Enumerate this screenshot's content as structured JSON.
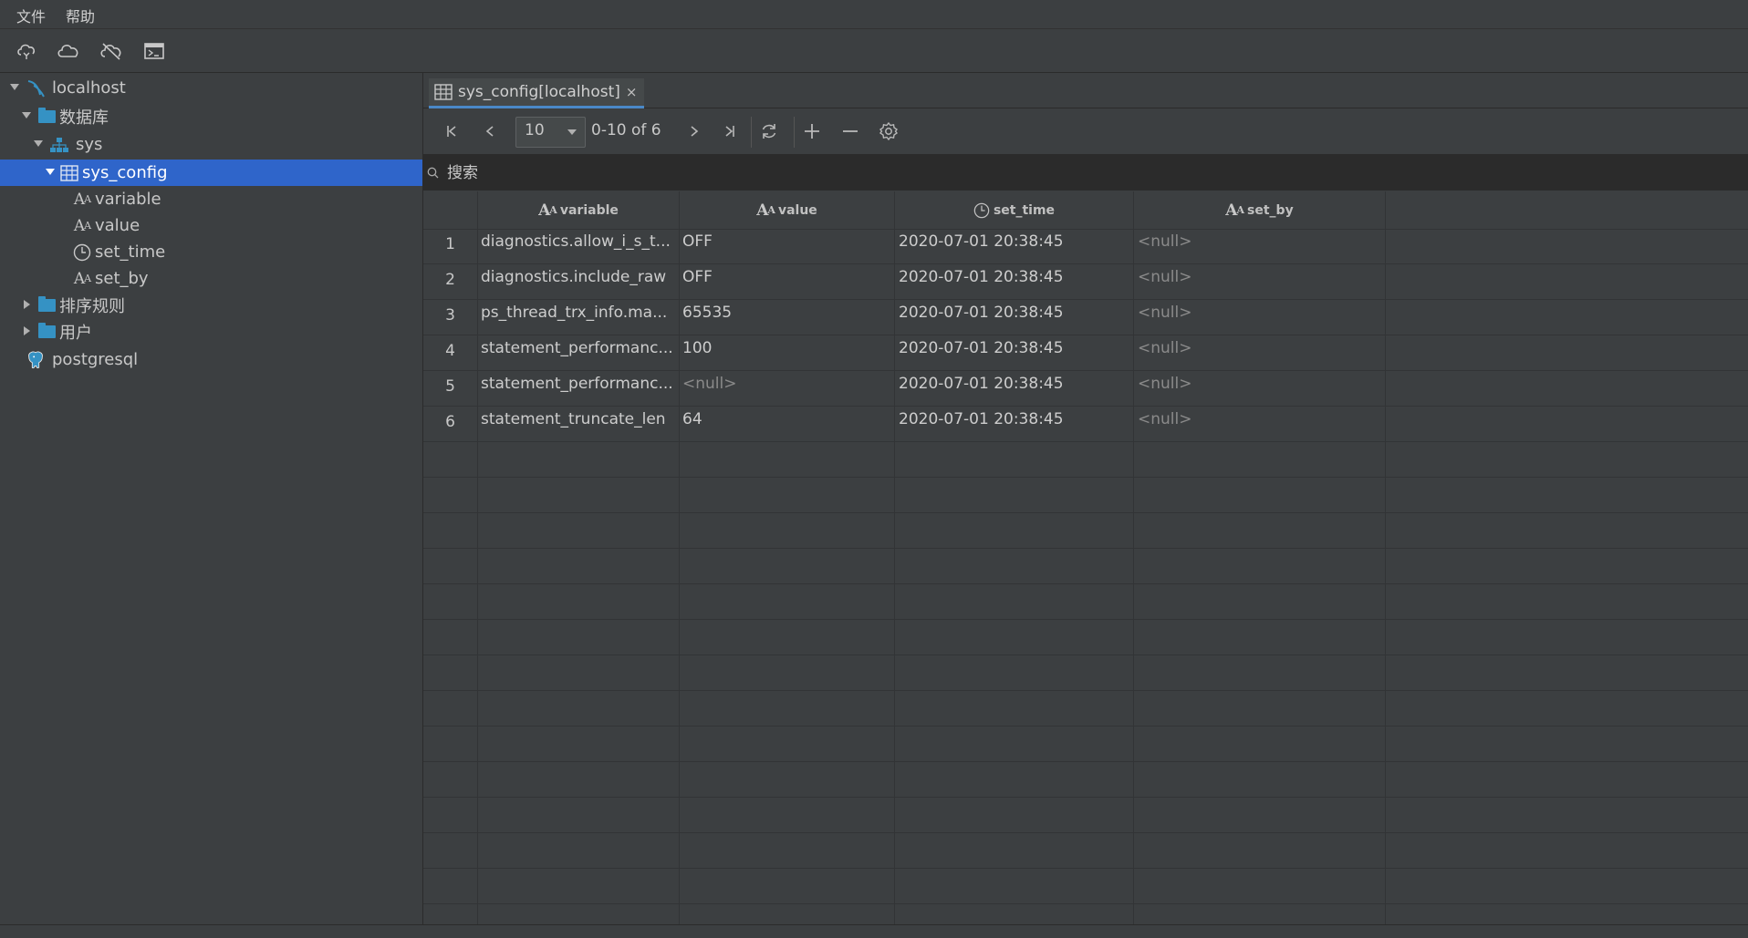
{
  "menu": {
    "file": "文件",
    "help": "帮助"
  },
  "toolbar": {
    "icons": [
      "cloud-connect-icon",
      "cloud-icon",
      "disconnect-icon",
      "terminal-icon"
    ]
  },
  "sidebar": {
    "localhost": "localhost",
    "databases": "数据库",
    "sys": "sys",
    "sys_config": "sys_config",
    "columns": {
      "variable": "variable",
      "value": "value",
      "set_time": "set_time",
      "set_by": "set_by"
    },
    "collations": "排序规则",
    "users": "用户",
    "postgresql": "postgresql"
  },
  "tab": {
    "label": "sys_config[localhost]",
    "close": "×"
  },
  "pager": {
    "page_size": "10",
    "info": "0-10 of 6"
  },
  "search": {
    "placeholder": "搜索"
  },
  "table": {
    "headers": {
      "variable": "variable",
      "value": "value",
      "set_time": "set_time",
      "set_by": "set_by"
    },
    "rows": [
      {
        "n": "1",
        "variable": "diagnostics.allow_i_s_t...",
        "value": "OFF",
        "set_time": "2020-07-01 20:38:45",
        "set_by": "<null>"
      },
      {
        "n": "2",
        "variable": "diagnostics.include_raw",
        "value": "OFF",
        "set_time": "2020-07-01 20:38:45",
        "set_by": "<null>"
      },
      {
        "n": "3",
        "variable": "ps_thread_trx_info.ma...",
        "value": "65535",
        "set_time": "2020-07-01 20:38:45",
        "set_by": "<null>"
      },
      {
        "n": "4",
        "variable": "statement_performanc...",
        "value": "100",
        "set_time": "2020-07-01 20:38:45",
        "set_by": "<null>"
      },
      {
        "n": "5",
        "variable": "statement_performanc...",
        "value": "<null>",
        "set_time": "2020-07-01 20:38:45",
        "set_by": "<null>"
      },
      {
        "n": "6",
        "variable": "statement_truncate_len",
        "value": "64",
        "set_time": "2020-07-01 20:38:45",
        "set_by": "<null>"
      }
    ]
  },
  "colors": {
    "selected": "#2f65ca",
    "accent": "#4a88c7",
    "folder": "#3592c4",
    "background": "#3c3f41"
  }
}
